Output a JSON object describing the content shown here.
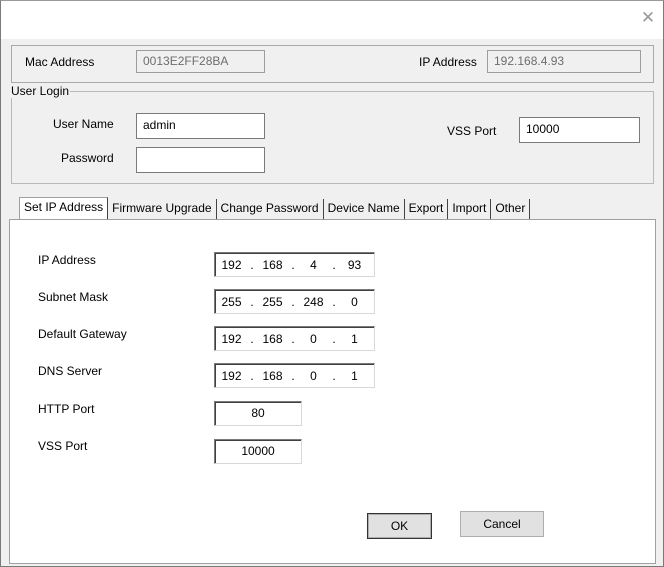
{
  "window": {
    "close_glyph": "✕"
  },
  "device": {
    "mac_label": "Mac Address",
    "mac_value": "0013E2FF28BA",
    "ip_label": "IP Address",
    "ip_value": "192.168.4.93"
  },
  "login": {
    "group_title": "User Login",
    "username_label": "User Name",
    "username_value": "admin",
    "password_label": "Password",
    "password_value": "",
    "vss_port_label": "VSS Port",
    "vss_port_value": "10000"
  },
  "tabs": [
    {
      "label": "Set IP Address",
      "active": true
    },
    {
      "label": "Firmware Upgrade",
      "active": false
    },
    {
      "label": "Change Password",
      "active": false
    },
    {
      "label": "Device Name",
      "active": false
    },
    {
      "label": "Export",
      "active": false
    },
    {
      "label": "Import",
      "active": false
    },
    {
      "label": "Other",
      "active": false
    }
  ],
  "network": {
    "ip_address": {
      "label": "IP Address",
      "octets": [
        "192",
        "168",
        "4",
        "93"
      ]
    },
    "subnet_mask": {
      "label": "Subnet Mask",
      "octets": [
        "255",
        "255",
        "248",
        "0"
      ]
    },
    "default_gateway": {
      "label": "Default Gateway",
      "octets": [
        "192",
        "168",
        "0",
        "1"
      ]
    },
    "dns_server": {
      "label": "DNS Server",
      "octets": [
        "192",
        "168",
        "0",
        "1"
      ]
    },
    "http_port": {
      "label": "HTTP Port",
      "value": "80"
    },
    "vss_port": {
      "label": "VSS Port",
      "value": "10000"
    },
    "dot": "."
  },
  "buttons": {
    "ok": "OK",
    "cancel": "Cancel"
  }
}
